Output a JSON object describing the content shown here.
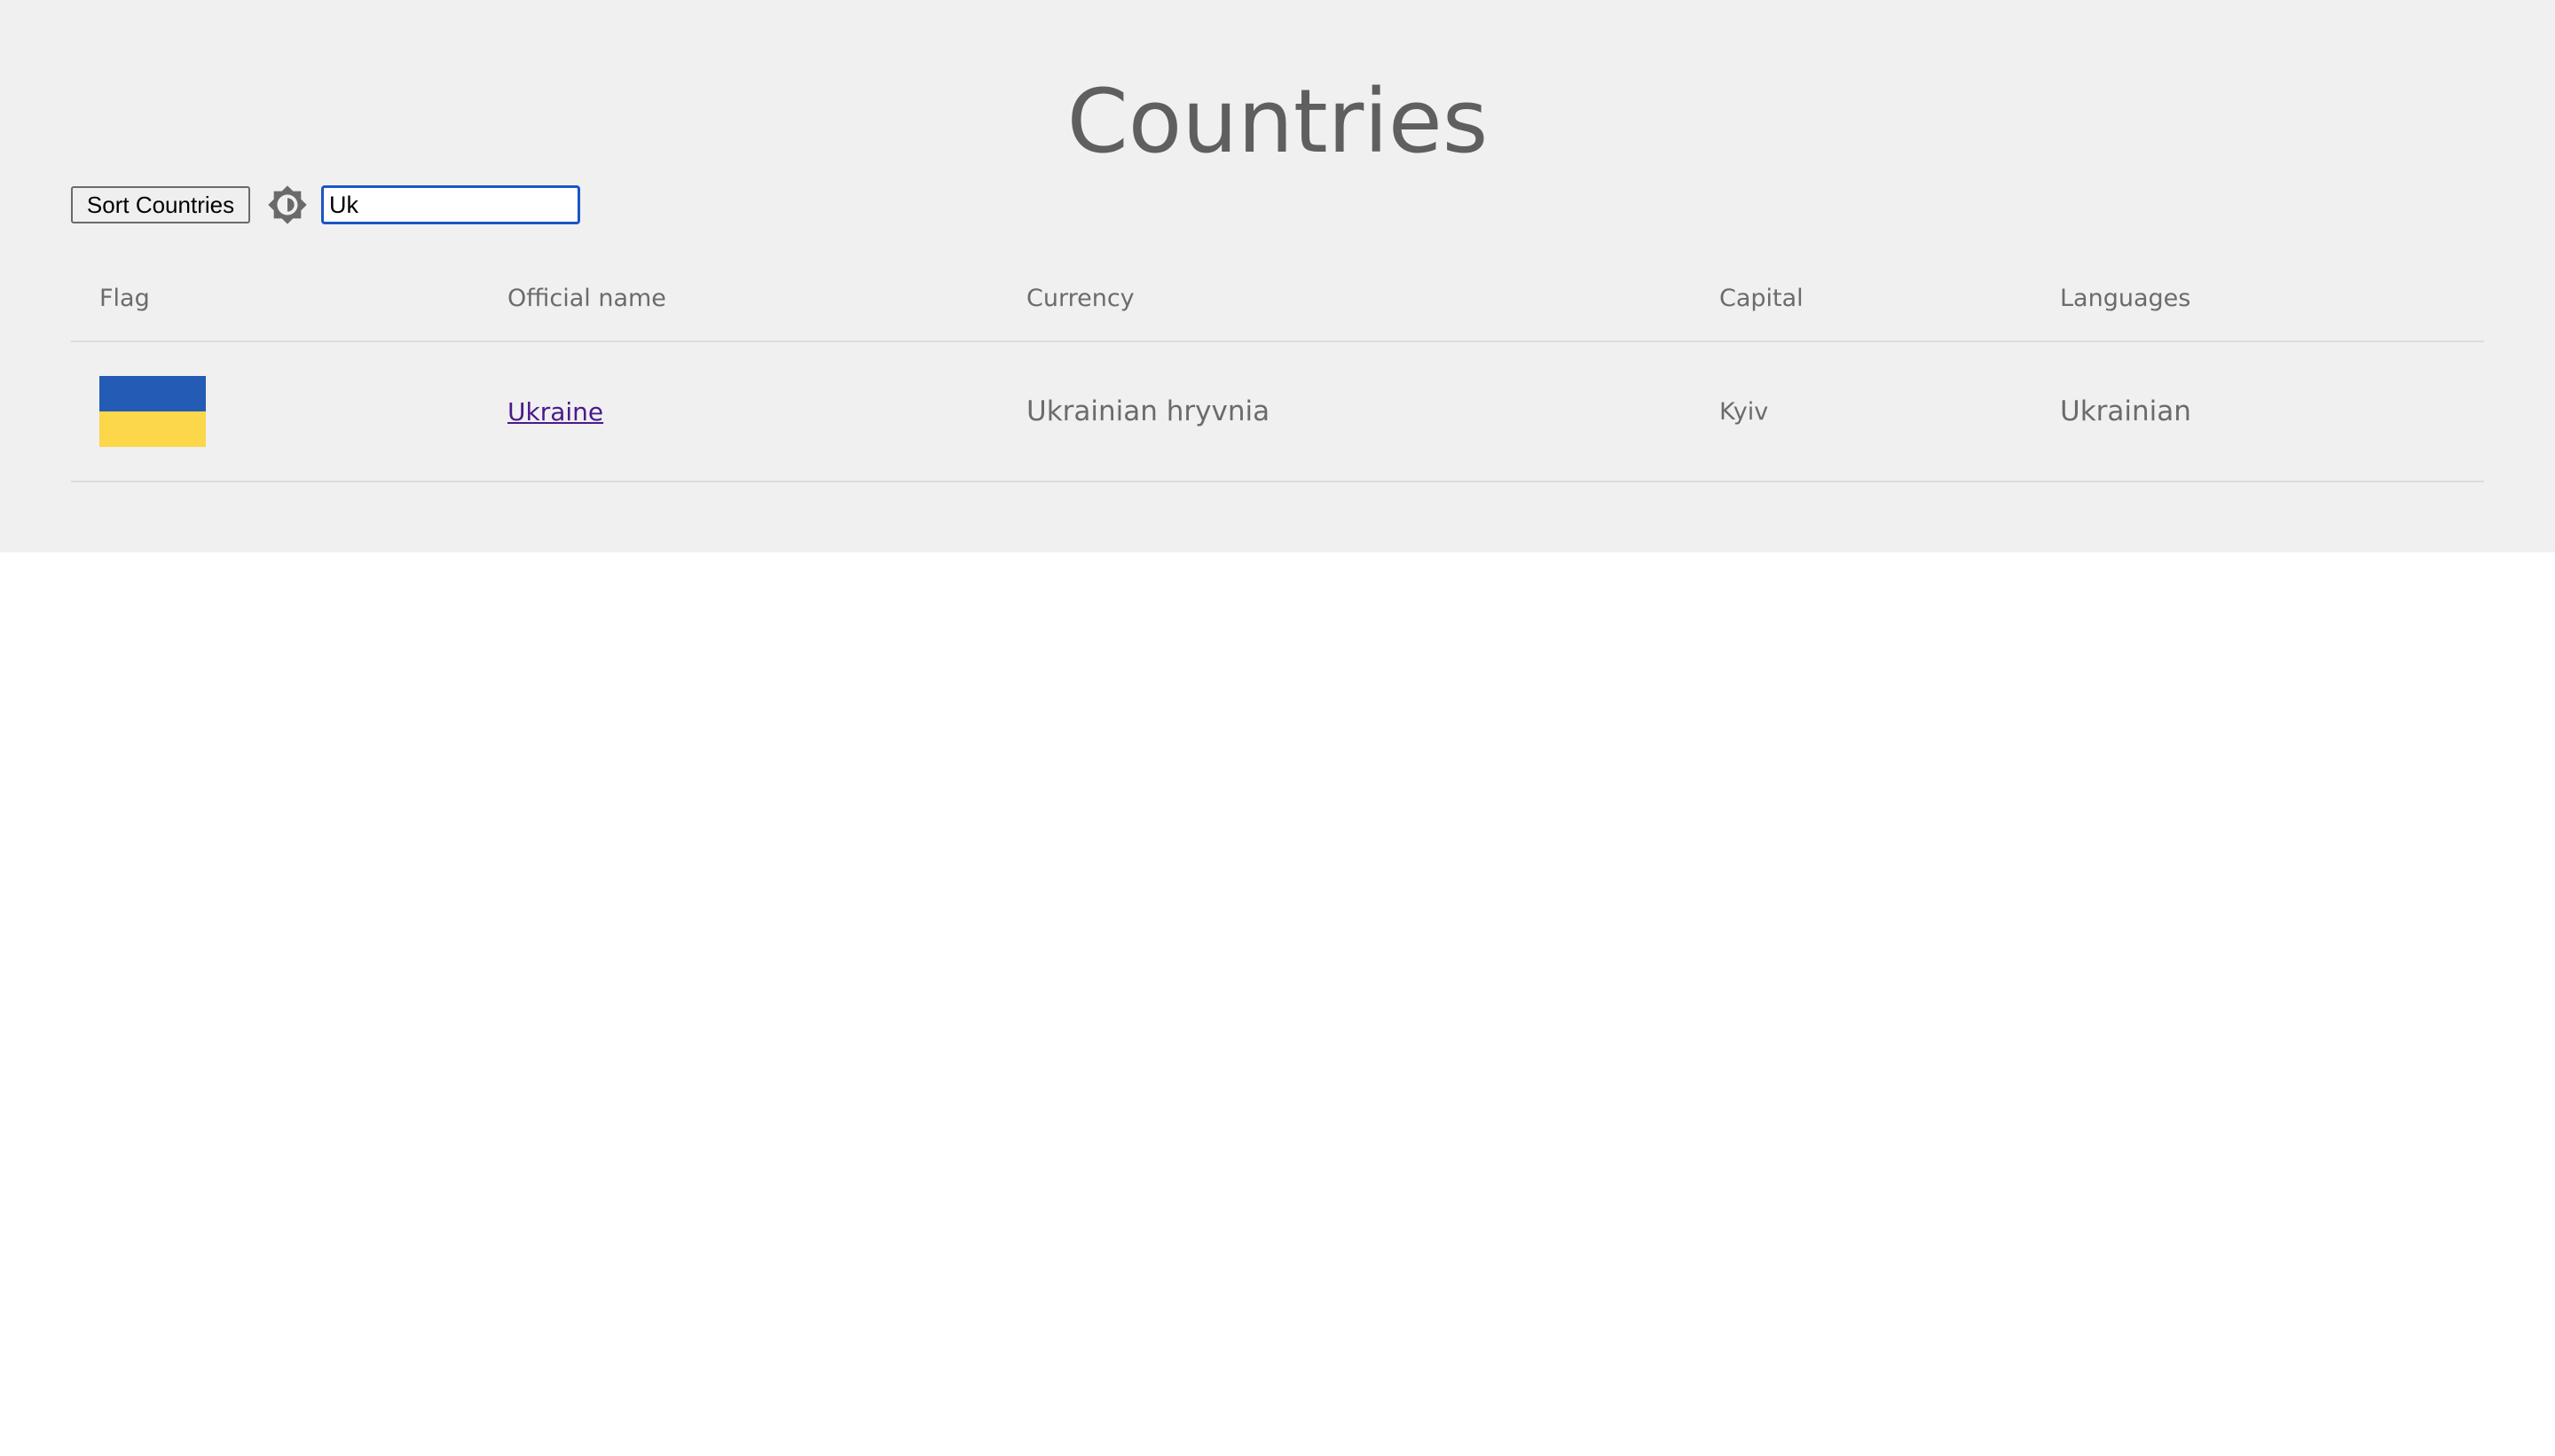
{
  "page": {
    "title": "Countries"
  },
  "controls": {
    "sort_label": "Sort Countries",
    "theme_icon": "brightness-icon",
    "search_value": "Uk"
  },
  "table": {
    "headers": [
      "Flag",
      "Official name",
      "Currency",
      "Capital",
      "Languages"
    ],
    "rows": [
      {
        "flag_colors": [
          "#245bb5",
          "#fbd749"
        ],
        "official_name": "Ukraine",
        "currency": "Ukrainian hryvnia",
        "capital": "Kyiv",
        "languages": "Ukrainian"
      }
    ]
  },
  "colors": {
    "panel_background": "#f0f0f0",
    "link": "#4a1a8c",
    "focus_border": "#1a56c6"
  }
}
